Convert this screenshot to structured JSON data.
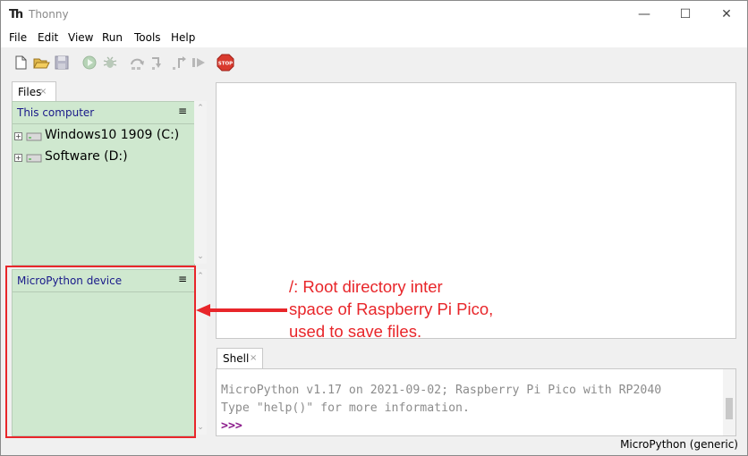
{
  "window": {
    "title": "Thonny",
    "icon_text": "Th",
    "minimize": "—",
    "maximize": "☐",
    "close": "✕"
  },
  "menu": [
    "File",
    "Edit",
    "View",
    "Run",
    "Tools",
    "Help"
  ],
  "toolbar": {
    "icons": [
      "new-file-icon",
      "open-folder-icon",
      "save-icon",
      "run-icon",
      "debug-icon",
      "step-over-icon",
      "step-into-icon",
      "step-out-icon",
      "resume-icon",
      "stop-icon"
    ],
    "stop_label": "STOP"
  },
  "files_tab": {
    "label": "Files",
    "close": "×"
  },
  "this_computer": {
    "title": "This computer",
    "menu": "≡",
    "drives": [
      {
        "label": "Windows10 1909 (C:)",
        "expander": "+"
      },
      {
        "label": "Software (D:)",
        "expander": "+"
      }
    ]
  },
  "micropython_device": {
    "title": "MicroPython device",
    "menu": "≡"
  },
  "shell": {
    "tab_label": "Shell",
    "close": "×",
    "lines": [
      "MicroPython v1.17 on 2021-09-02; Raspberry Pi Pico with RP2040",
      "Type \"help()\" for more information."
    ],
    "prompt": ">>>"
  },
  "status": {
    "interpreter": "MicroPython (generic)"
  },
  "annotation": {
    "lines": [
      "/: Root directory inter",
      "space of Raspberry Pi Pico,",
      "used to save files."
    ],
    "color": "#e8262a"
  },
  "colors": {
    "panel_bg": "#cfe8cf",
    "panel_title": "#1a1a8a",
    "prompt": "#8b1a8b"
  }
}
